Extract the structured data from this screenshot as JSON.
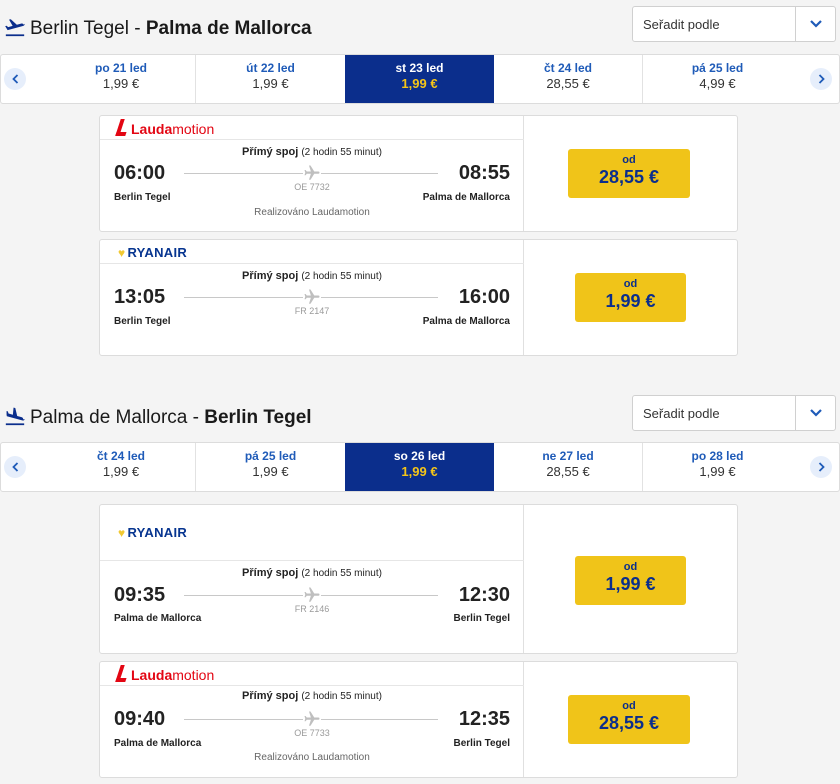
{
  "outbound": {
    "title_from": "Berlin Tegel",
    "title_sep": " - ",
    "title_to": "Palma de Mallorca",
    "sort_label": "Seřadit podle",
    "dates": [
      {
        "day": "po 21 led",
        "price": "1,99 €"
      },
      {
        "day": "út 22 led",
        "price": "1,99 €"
      },
      {
        "day": "st 23 led",
        "price": "1,99 €"
      },
      {
        "day": "čt 24 led",
        "price": "28,55 €"
      },
      {
        "day": "pá 25 led",
        "price": "4,99 €"
      }
    ],
    "flights": [
      {
        "airline": "Laudamotion",
        "airline_a": "Lauda",
        "airline_b": "motion",
        "dep_time": "06:00",
        "arr_time": "08:55",
        "dep_city": "Berlin Tegel",
        "arr_city": "Palma de Mallorca",
        "direct": "Přímý spoj",
        "duration": "(2 hodin 55 minut)",
        "flight_no": "OE 7732",
        "operated": "Realizováno Laudamotion",
        "od": "od",
        "price": "28,55 €"
      },
      {
        "airline": "RYANAIR",
        "dep_time": "13:05",
        "arr_time": "16:00",
        "dep_city": "Berlin Tegel",
        "arr_city": "Palma de Mallorca",
        "direct": "Přímý spoj",
        "duration": "(2 hodin 55 minut)",
        "flight_no": "FR 2147",
        "od": "od",
        "price": "1,99 €"
      }
    ]
  },
  "inbound": {
    "title_from": "Palma de Mallorca",
    "title_sep": " - ",
    "title_to": "Berlin Tegel",
    "sort_label": "Seřadit podle",
    "dates": [
      {
        "day": "čt 24 led",
        "price": "1,99 €"
      },
      {
        "day": "pá 25 led",
        "price": "1,99 €"
      },
      {
        "day": "so 26 led",
        "price": "1,99 €"
      },
      {
        "day": "ne 27 led",
        "price": "28,55 €"
      },
      {
        "day": "po 28 led",
        "price": "1,99 €"
      }
    ],
    "flights": [
      {
        "airline": "RYANAIR",
        "dep_time": "09:35",
        "arr_time": "12:30",
        "dep_city": "Palma de Mallorca",
        "arr_city": "Berlin Tegel",
        "direct": "Přímý spoj",
        "duration": "(2 hodin 55 minut)",
        "flight_no": "FR 2146",
        "od": "od",
        "price": "1,99 €"
      },
      {
        "airline": "Laudamotion",
        "airline_a": "Lauda",
        "airline_b": "motion",
        "dep_time": "09:40",
        "arr_time": "12:35",
        "dep_city": "Palma de Mallorca",
        "arr_city": "Berlin Tegel",
        "direct": "Přímý spoj",
        "duration": "(2 hodin 55 minut)",
        "flight_no": "OE 7733",
        "operated": "Realizováno Laudamotion",
        "od": "od",
        "price": "28,55 €"
      }
    ]
  },
  "colors": {
    "accent_blue": "#0b2e8c",
    "link_blue": "#1f5bb8",
    "price_yellow": "#f0c419",
    "lauda_red": "#e30613"
  }
}
